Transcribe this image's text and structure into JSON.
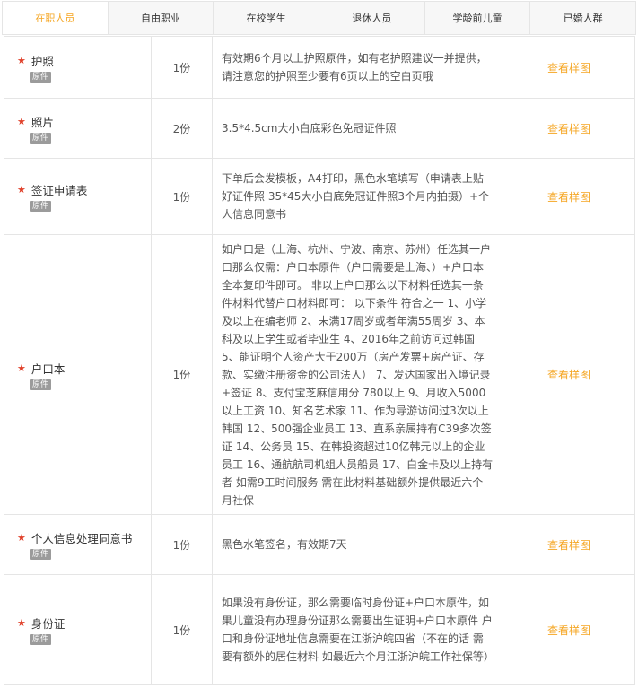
{
  "tabs": [
    {
      "label": "在职人员",
      "active": true
    },
    {
      "label": "自由职业",
      "active": false
    },
    {
      "label": "在校学生",
      "active": false
    },
    {
      "label": "退休人员",
      "active": false
    },
    {
      "label": "学龄前儿童",
      "active": false
    },
    {
      "label": "已婚人群",
      "active": false
    }
  ],
  "badge_label": "原件",
  "action_label": "查看样图",
  "rows": [
    {
      "name": "护照",
      "badge": "原件",
      "qty": "1份",
      "desc": "有效期6个月以上护照原件，如有老护照建议一并提供，请注意您的护照至少要有6页以上的空白页哦",
      "action": "查看样图"
    },
    {
      "name": "照片",
      "badge": "原件",
      "qty": "2份",
      "desc": "3.5*4.5cm大小白底彩色免冠证件照",
      "action": "查看样图"
    },
    {
      "name": "签证申请表",
      "badge": "原件",
      "qty": "1份",
      "desc": "下单后会发模板，A4打印，黑色水笔填写（申请表上贴好证件照 35*45大小白底免冠证件照3个月内拍摄）+个人信息同意书",
      "action": "查看样图"
    },
    {
      "name": "户口本",
      "badge": "原件",
      "qty": "1份",
      "desc": "如户口是（上海、杭州、宁波、南京、苏州）任选其一户口那么仅需：户口本原件（户口需要是上海、）+户口本全本复印件即可。 非以上户口那么以下材料任选其一条件材料代替户口材料即可： 以下条件 符合之一 1、小学及以上在编老师 2、未满17周岁或者年满55周岁 3、本科及以上学生或者毕业生 4、2016年之前访问过韩国 5、能证明个人资产大于200万（房产发票+房产证、存款、实缴注册资金的公司法人） 7、发达国家出入境记录+签证 8、支付宝芝麻信用分 780以上 9、月收入5000以上工资 10、知名艺术家 11、作为导游访问过3次以上韩国 12、500强企业员工 13、直系亲属持有C39多次签证 14、公务员 15、在韩投资超过10亿韩元以上的企业员工 16、通航航司机组人员船员 17、白金卡及以上持有者 如需9工时间服务 需在此材料基础额外提供最近六个月社保",
      "action": "查看样图"
    },
    {
      "name": "个人信息处理同意书",
      "badge": "原件",
      "qty": "1份",
      "desc": "黑色水笔签名，有效期7天",
      "action": "查看样图"
    },
    {
      "name": "身份证",
      "badge": "原件",
      "qty": "1份",
      "desc": "如果没有身份证，那么需要临时身份证+户口本原件，如果儿童没有办理身份证那么需要出生证明+户口本原件 户口和身份证地址信息需要在江浙沪皖四省（不在的话 需要有额外的居住材料 如最近六个月江浙沪皖工作社保等）",
      "action": "查看样图"
    }
  ],
  "colors": {
    "accent": "#f5a623",
    "star": "#e0412b",
    "badge_bg": "#9b9b9b",
    "border": "#e5e5e5"
  }
}
